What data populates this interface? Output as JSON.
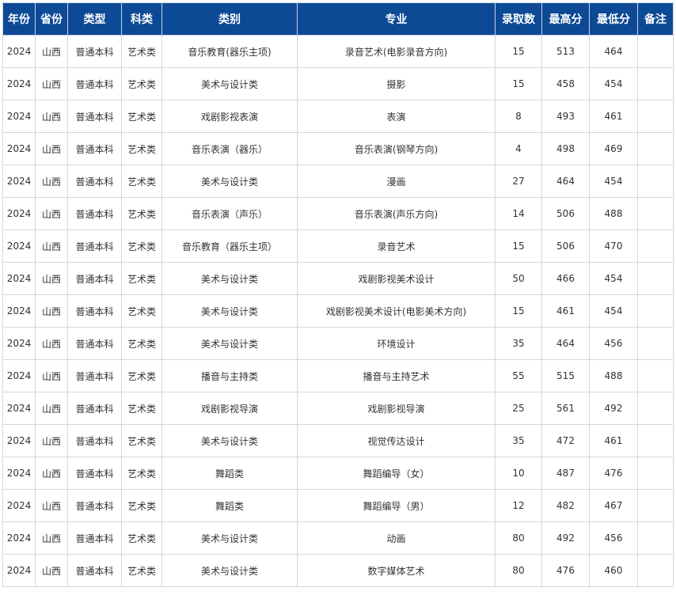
{
  "table": {
    "headers": [
      "年份",
      "省份",
      "类型",
      "科类",
      "类别",
      "专业",
      "录取数",
      "最高分",
      "最低分",
      "备注"
    ],
    "rows": [
      [
        "2024",
        "山西",
        "普通本科",
        "艺术类",
        "音乐教育(器乐主项)",
        "录音艺术(电影录音方向)",
        "15",
        "513",
        "464",
        ""
      ],
      [
        "2024",
        "山西",
        "普通本科",
        "艺术类",
        "美术与设计类",
        "摄影",
        "15",
        "458",
        "454",
        ""
      ],
      [
        "2024",
        "山西",
        "普通本科",
        "艺术类",
        "戏剧影视表演",
        "表演",
        "8",
        "493",
        "461",
        ""
      ],
      [
        "2024",
        "山西",
        "普通本科",
        "艺术类",
        "音乐表演（器乐）",
        "音乐表演(钢琴方向)",
        "4",
        "498",
        "469",
        ""
      ],
      [
        "2024",
        "山西",
        "普通本科",
        "艺术类",
        "美术与设计类",
        "漫画",
        "27",
        "464",
        "454",
        ""
      ],
      [
        "2024",
        "山西",
        "普通本科",
        "艺术类",
        "音乐表演（声乐）",
        "音乐表演(声乐方向)",
        "14",
        "506",
        "488",
        ""
      ],
      [
        "2024",
        "山西",
        "普通本科",
        "艺术类",
        "音乐教育（器乐主项）",
        "录音艺术",
        "15",
        "506",
        "470",
        ""
      ],
      [
        "2024",
        "山西",
        "普通本科",
        "艺术类",
        "美术与设计类",
        "戏剧影视美术设计",
        "50",
        "466",
        "454",
        ""
      ],
      [
        "2024",
        "山西",
        "普通本科",
        "艺术类",
        "美术与设计类",
        "戏剧影视美术设计(电影美术方向)",
        "15",
        "461",
        "454",
        ""
      ],
      [
        "2024",
        "山西",
        "普通本科",
        "艺术类",
        "美术与设计类",
        "环境设计",
        "35",
        "464",
        "456",
        ""
      ],
      [
        "2024",
        "山西",
        "普通本科",
        "艺术类",
        "播音与主持类",
        "播音与主持艺术",
        "55",
        "515",
        "488",
        ""
      ],
      [
        "2024",
        "山西",
        "普通本科",
        "艺术类",
        "戏剧影视导演",
        "戏剧影视导演",
        "25",
        "561",
        "492",
        ""
      ],
      [
        "2024",
        "山西",
        "普通本科",
        "艺术类",
        "美术与设计类",
        "视觉传达设计",
        "35",
        "472",
        "461",
        ""
      ],
      [
        "2024",
        "山西",
        "普通本科",
        "艺术类",
        "舞蹈类",
        "舞蹈编导（女）",
        "10",
        "487",
        "476",
        ""
      ],
      [
        "2024",
        "山西",
        "普通本科",
        "艺术类",
        "舞蹈类",
        "舞蹈编导（男）",
        "12",
        "482",
        "467",
        ""
      ],
      [
        "2024",
        "山西",
        "普通本科",
        "艺术类",
        "美术与设计类",
        "动画",
        "80",
        "492",
        "456",
        ""
      ],
      [
        "2024",
        "山西",
        "普通本科",
        "艺术类",
        "美术与设计类",
        "数字媒体艺术",
        "80",
        "476",
        "460",
        ""
      ]
    ]
  },
  "colors": {
    "header_bg": "#0d4a96",
    "header_text": "#ffffff",
    "cell_text": "#333333",
    "border": "#d6d6d6"
  }
}
